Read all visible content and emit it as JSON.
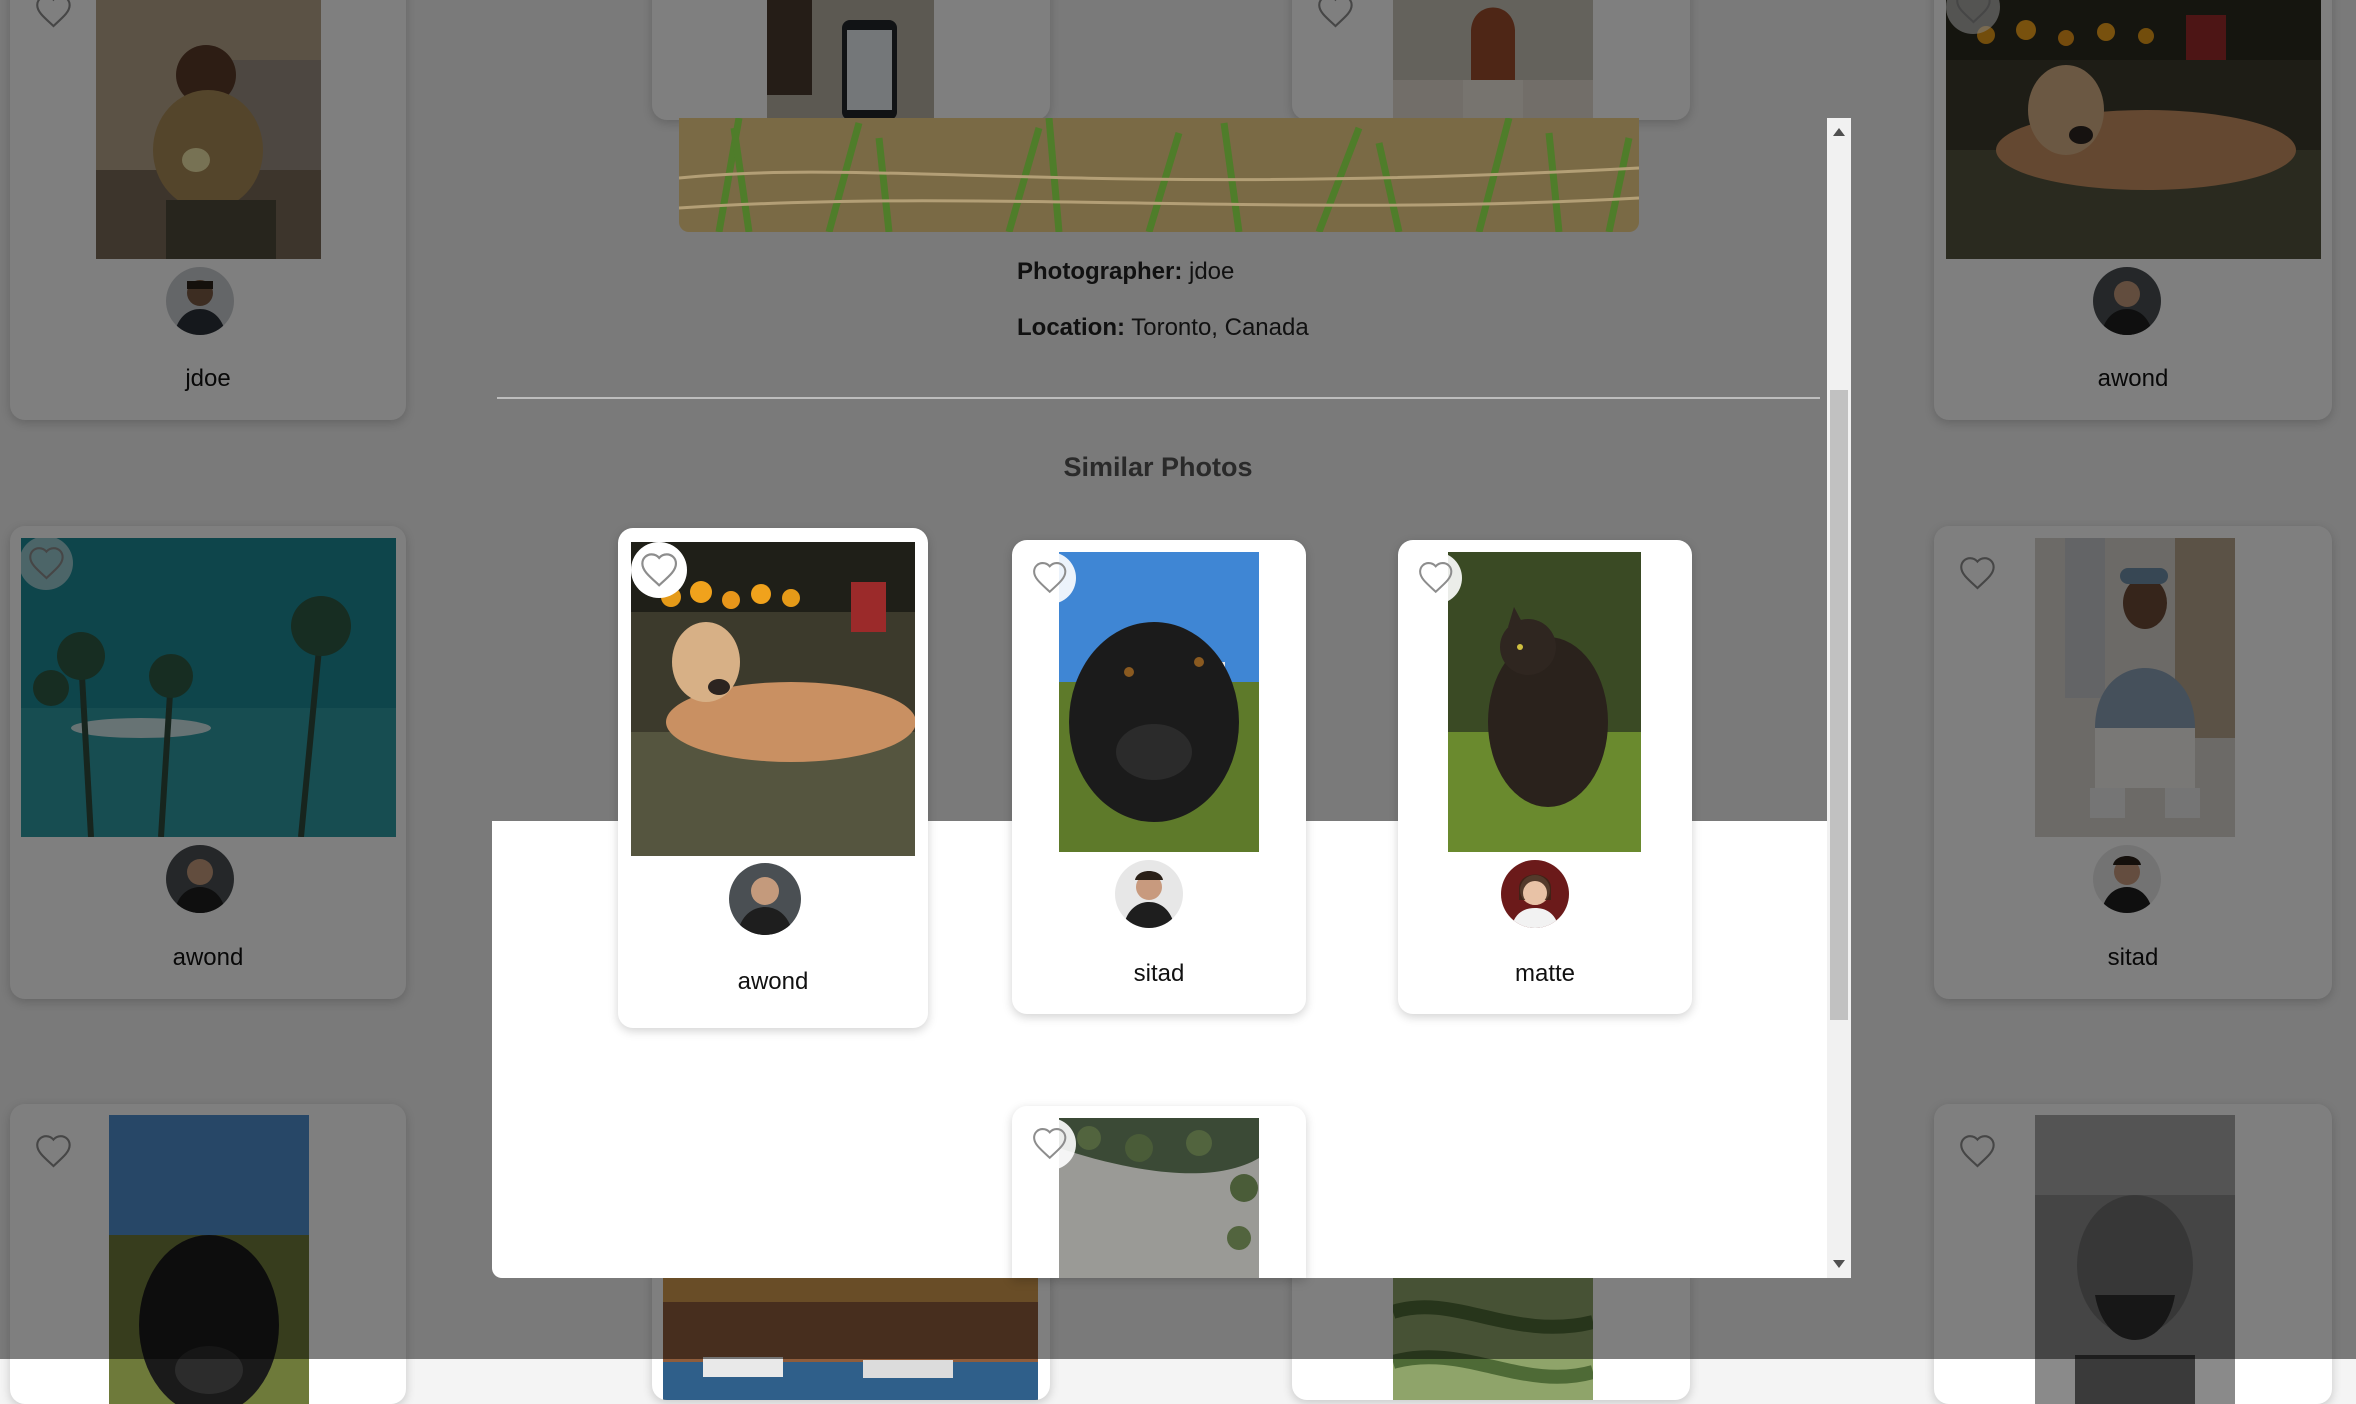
{
  "background_cards": [
    {
      "username": "jdoe"
    },
    {
      "username": "awond"
    },
    {
      "username": "awond"
    },
    {
      "username": "sitad"
    }
  ],
  "modal": {
    "photographer_label": "Photographer:",
    "photographer_value": "jdoe",
    "location_label": "Location:",
    "location_value": "Toronto, Canada",
    "similar_title": "Similar Photos",
    "similar": [
      {
        "username": "awond",
        "photo": "dog lying on grass"
      },
      {
        "username": "sitad",
        "photo": "black dog close-up"
      },
      {
        "username": "matte",
        "photo": "cat in grass"
      },
      {
        "username": "",
        "photo": "leaves on wall"
      }
    ]
  },
  "icons": {
    "like": "heart-outline-icon",
    "scroll_up": "scroll-up-arrow-icon",
    "scroll_down": "scroll-down-arrow-icon"
  },
  "colors": {
    "overlay": "rgba(0,0,0,0.5)",
    "card": "#ffffff",
    "scroll_thumb": "#c1c1c1"
  }
}
